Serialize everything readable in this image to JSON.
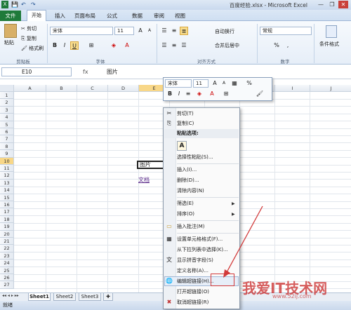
{
  "window": {
    "title": "百度经验.xlsx - Microsoft Excel",
    "minimize": "—",
    "restore": "❐",
    "close": "✕"
  },
  "qat": {
    "save": "💾",
    "undo": "↶",
    "redo": "↷"
  },
  "tabs": [
    "插入",
    "页面布局",
    "公式",
    "数据",
    "审阅",
    "视图"
  ],
  "file_tab": "文件",
  "home_tab": "开始",
  "ribbon": {
    "clipboard": {
      "paste": "粘贴",
      "cut": "剪切",
      "copy": "复制",
      "format_painter": "格式刷",
      "label": "剪贴板"
    },
    "font": {
      "name": "宋体",
      "size": "11",
      "grow": "A",
      "shrink": "A",
      "bold": "B",
      "italic": "I",
      "underline": "U",
      "label": "字体"
    },
    "alignment": {
      "wrap": "自动换行",
      "merge": "合并后居中",
      "label": "对齐方式"
    },
    "number": {
      "format": "常规",
      "percent": "%",
      "comma": ",",
      "label": "数字"
    },
    "styles": {
      "conditional": "条件格式"
    }
  },
  "namebox": "E10",
  "fx": "fx",
  "formula": "图片",
  "columns": [
    "A",
    "B",
    "C",
    "D",
    "E",
    "F",
    "G",
    "H",
    "I",
    "J"
  ],
  "rows": [
    "1",
    "2",
    "3",
    "4",
    "5",
    "6",
    "7",
    "8",
    "9",
    "10",
    "11",
    "12",
    "13",
    "14",
    "15",
    "16",
    "17",
    "18",
    "19",
    "20",
    "21",
    "22",
    "23",
    "24",
    "25",
    "26",
    "27"
  ],
  "cells": {
    "e10": "图片",
    "e12": "文档"
  },
  "sheets": [
    "Sheet1",
    "Sheet2",
    "Sheet3"
  ],
  "status": "就绪",
  "mini_toolbar": {
    "font": "宋体",
    "size": "11",
    "bold": "B",
    "italic": "I",
    "center": "≡",
    "percent": "%"
  },
  "menu": {
    "cut": "剪切(T)",
    "copy": "复制(C)",
    "paste_options": "粘贴选项:",
    "paste_icon": "A",
    "paste_special": "选择性粘贴(S)...",
    "insert": "插入(I)...",
    "delete": "删除(D)...",
    "clear": "清除内容(N)",
    "filter": "筛选(E)",
    "sort": "排序(O)",
    "comment": "插入批注(M)",
    "format_cells": "设置单元格格式(F)...",
    "dropdown": "从下拉列表中选择(K)...",
    "phonetic": "显示拼音字段(S)",
    "define_name": "定义名称(A)...",
    "edit_hyperlink": "编辑超链接(H)...",
    "open_hyperlink": "打开超链接(O)",
    "remove_hyperlink": "取消超链接(R)"
  },
  "watermark": {
    "text": "我爱IT技术网",
    "url": "www.52ij.com"
  },
  "colors": {
    "accent": "#1f7a3a",
    "highlight": "#e7eef8",
    "annotation": "#d23a3a"
  }
}
